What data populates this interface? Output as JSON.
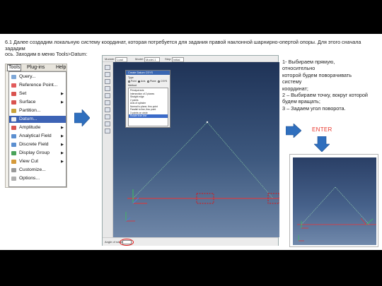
{
  "slide": {
    "heading": "6.1 Далее создадим локальную систему координат, которая потребуется для задания правой наклонной шарнирно-опертой опоры. Для этого сначала зададим",
    "heading_line3": "ось. Заходим в меню Tools>Datum:"
  },
  "tools_menu": {
    "menubar": [
      "Tools",
      "Plug-ins",
      "Help"
    ],
    "items": [
      {
        "label": "Query...",
        "arrow": ""
      },
      {
        "label": "Reference Point...",
        "arrow": ""
      },
      {
        "label": "Set",
        "arrow": "▶"
      },
      {
        "label": "Surface",
        "arrow": "▶"
      },
      {
        "label": "Partition...",
        "arrow": ""
      },
      {
        "label": "Datum...",
        "arrow": ""
      },
      {
        "label": "Amplitude",
        "arrow": "▶"
      },
      {
        "label": "Analytical Field",
        "arrow": "▶"
      },
      {
        "label": "Discrete Field",
        "arrow": "▶"
      },
      {
        "label": "Display Group",
        "arrow": "▶"
      },
      {
        "label": "View Cut",
        "arrow": "▶"
      },
      {
        "label": "Customize...",
        "arrow": ""
      },
      {
        "label": "Options...",
        "arrow": ""
      }
    ],
    "highlighted_index": 5
  },
  "abaqus": {
    "toolbar": [
      "Module:",
      "Load",
      "Model:",
      "Model-1",
      "Step:",
      "Initial"
    ],
    "status_prompt": "Angle of rotation:",
    "dialog": {
      "title": "Create Datum CSYS",
      "type_label": "Type",
      "radios": [
        "Point",
        "Axis",
        "Plane",
        "CSYS"
      ],
      "selected_radio": 1,
      "method_label": "Method",
      "methods": [
        "Principal axis",
        "Intersection of 2 planes",
        "Straight edge",
        "2 points",
        "Axis of cylinder",
        "Normal to plane, thru point",
        "Parallel to line, thru point",
        "3 points on circle",
        "Rotate from line"
      ],
      "selected_method": 8
    }
  },
  "instructions": [
    "1- Выбираем прямую,",
    "относительно",
    "которой будем поворачивать",
    "систему",
    "координат;",
    "2 – Выбираем точку, вокруг которой",
    "будем вращать;",
    "3 – Задаем угол поворота."
  ],
  "enter_label": "ENTER",
  "colors": {
    "accent_red": "#e8352b",
    "arrow_blue": "#2f6fbe",
    "highlight": "#3d63b5"
  }
}
